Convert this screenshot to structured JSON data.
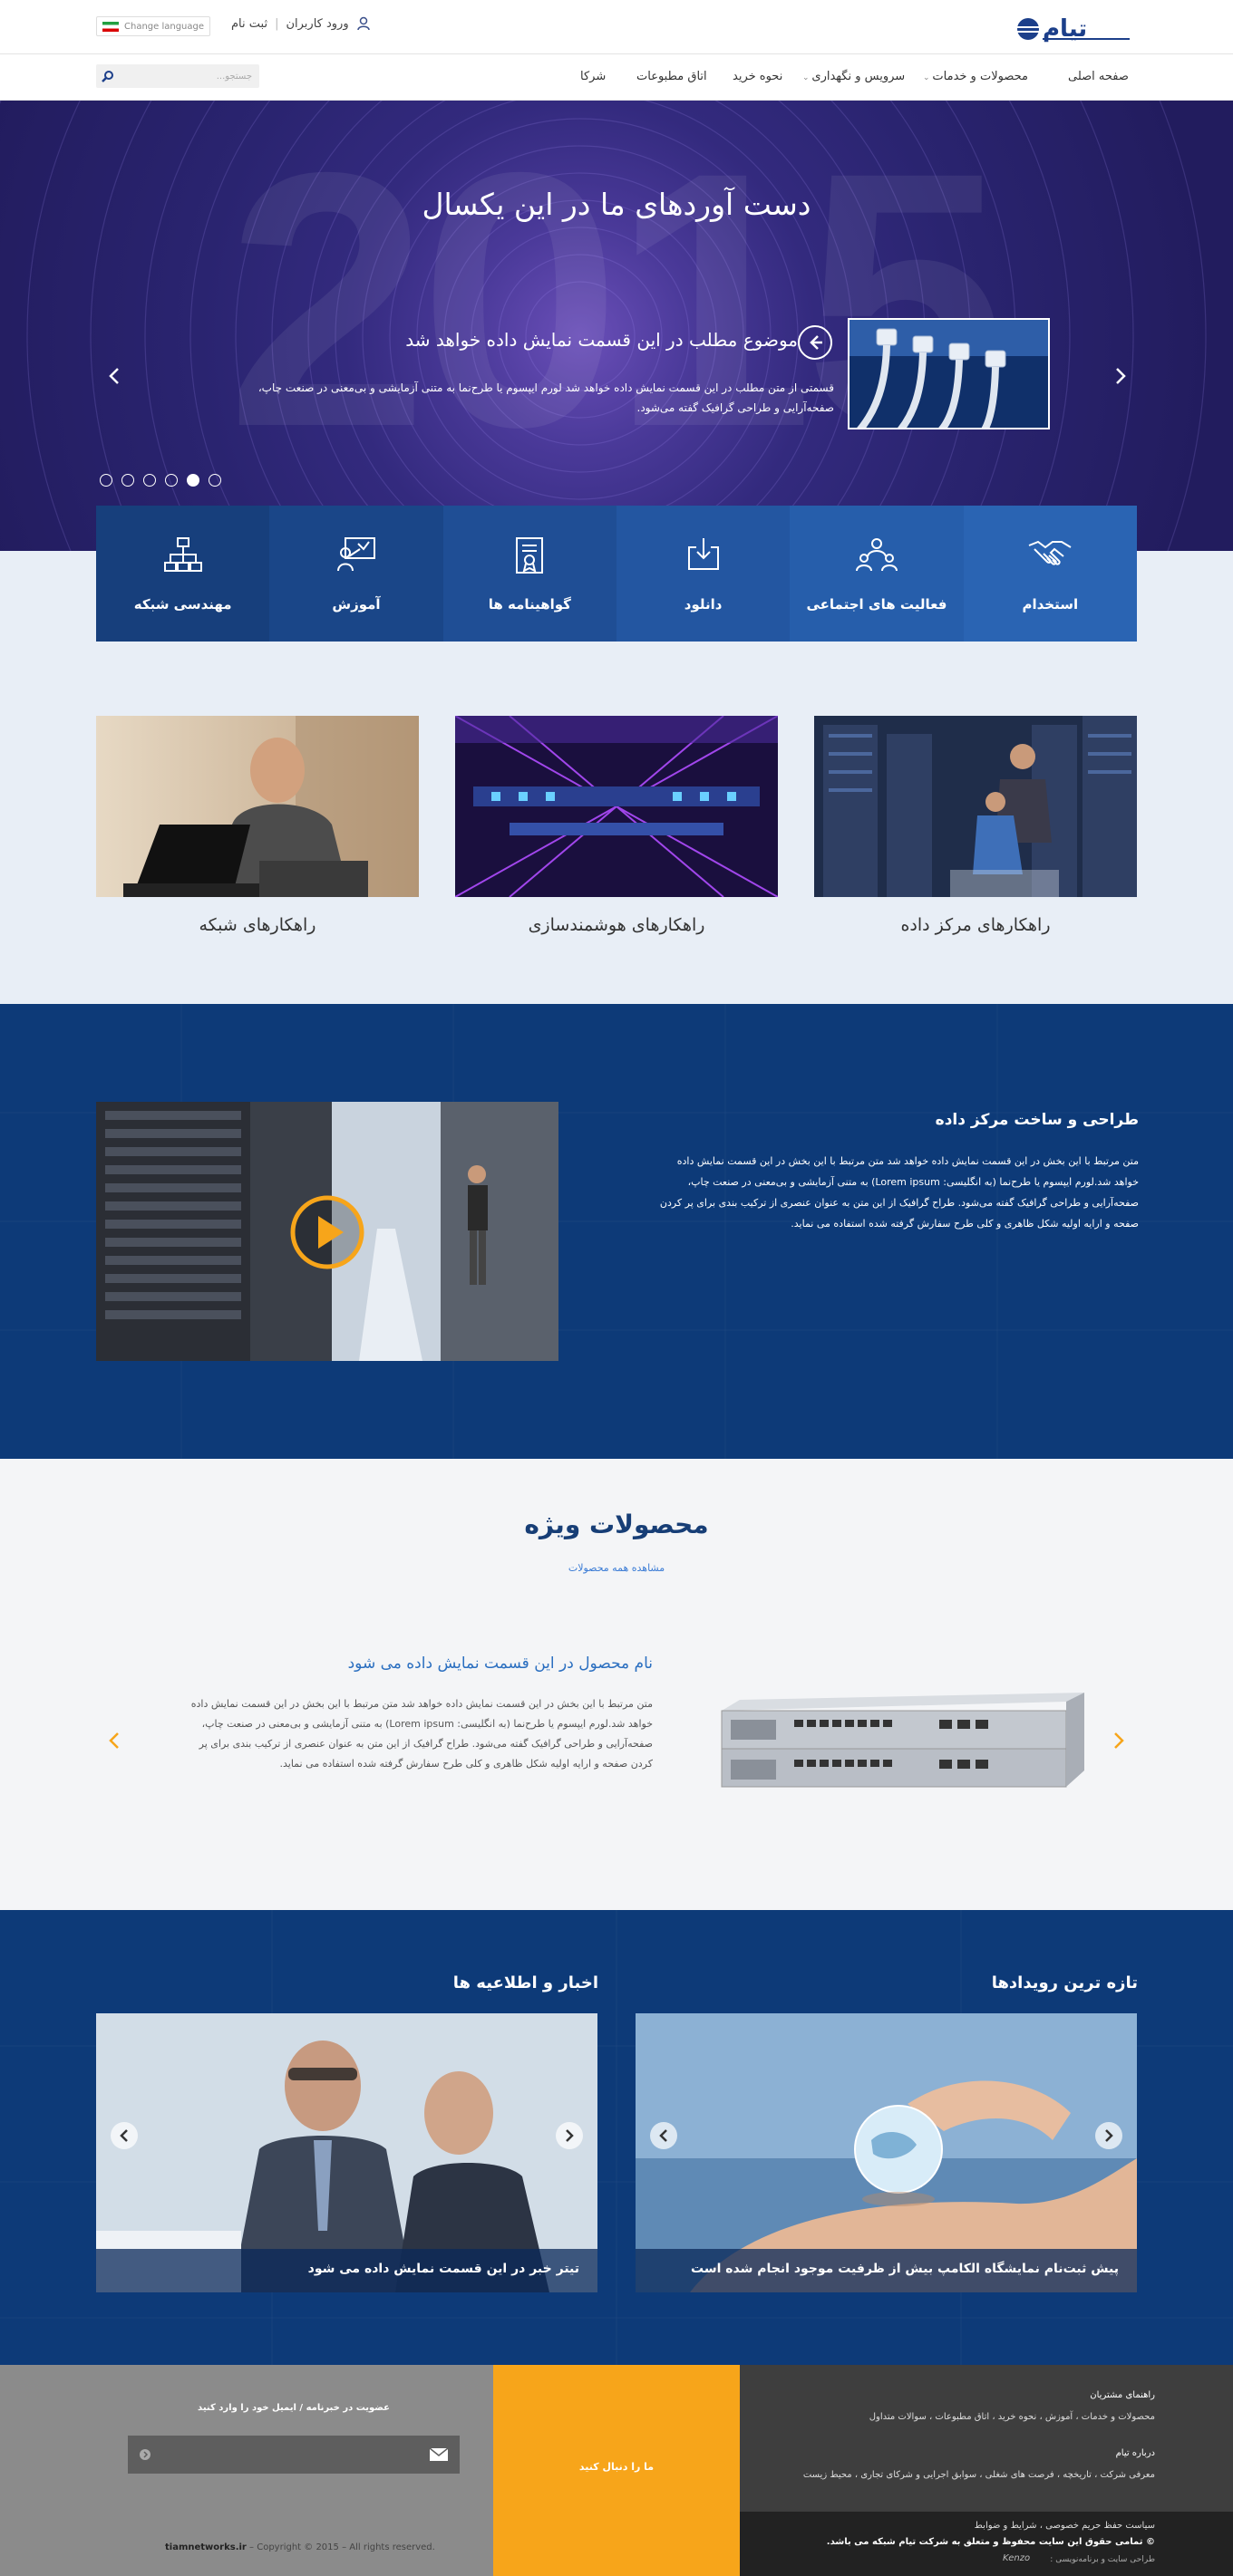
{
  "header": {
    "logo_text": "تیام",
    "login_label": "ورود کاربران",
    "separator": "|",
    "register_label": "ثبت نام",
    "language_label": "Change language"
  },
  "nav": {
    "items": [
      "صفحه اصلی",
      "محصولات و خدمات",
      "سرویس و نگهداری",
      "نحوه خرید",
      "اتاق مطبوعات",
      "شرکا"
    ],
    "search_placeholder": "جستجو..."
  },
  "hero": {
    "title": "دست آوردهای ما در این یکسال",
    "year_watermark": "2015",
    "slide_title": "موضوع مطلب در این قسمت نمایش داده خواهد شد",
    "slide_text": "قسمتی از متن مطلب در این قسمت نمایش داده خواهد شد لورم ایپسوم یا طرح‌نما به متنی آزمایشی و بی‌معنی در صنعت چاپ، صفحه‌آرایی و طراحی گرافیک گفته می‌شود.",
    "dots_count": 6,
    "active_dot": 5
  },
  "tiles": [
    {
      "label": "مهندسی شبکه",
      "icon": "network-icon",
      "color": "#173f7c"
    },
    {
      "label": "آموزش",
      "icon": "training-icon",
      "color": "#1a4688"
    },
    {
      "label": "گواهینامه ها",
      "icon": "certificate-icon",
      "color": "#1f4e95"
    },
    {
      "label": "دانلود",
      "icon": "download-icon",
      "color": "#2356a1"
    },
    {
      "label": "فعالیت های اجتماعی",
      "icon": "community-icon",
      "color": "#265eab"
    },
    {
      "label": "استخدام",
      "icon": "handshake-icon",
      "color": "#2a64b3"
    }
  ],
  "solutions": [
    {
      "label": "راهکارهای شبکه"
    },
    {
      "label": "راهکارهای هوشمندسازی"
    },
    {
      "label": "راهکارهای مرکز داده"
    }
  ],
  "datacenter": {
    "title": "طراحی و ساخت مرکز داده",
    "text": "متن مرتبط با این بخش در این قسمت نمایش داده خواهد شد متن مرتبط با این بخش در این قسمت نمایش داده خواهد شد.لورم ایپسوم یا طرح‌نما (به انگلیسی: Lorem ipsum) به متنی آزمایشی و بی‌معنی در صنعت چاپ، صفحه‌آرایی و طراحی گرافیک گفته می‌شود. طراح گرافیک از این متن به عنوان عنصری از ترکیب بندی برای پر کردن صفحه و ارایه اولیه شکل ظاهری و کلی طرح سفارش گرفته شده استفاده می نماید."
  },
  "featured": {
    "title": "محصولات ویژه",
    "view_all": "مشاهده همه محصولات",
    "product_name": "نام محصول در این قسمت نمایش داده می شود",
    "product_text": "متن مرتبط با این بخش در این قسمت نمایش داده خواهد شد متن مرتبط با این بخش در این قسمت نمایش داده خواهد شد.لورم ایپسوم یا طرح‌نما (به انگلیسی: Lorem ipsum) به متنی آزمایشی و بی‌معنی در صنعت چاپ، صفحه‌آرایی و طراحی گرافیک گفته می‌شود. طراح گرافیک از این متن به عنوان عنصری از ترکیب بندی برای پر کردن صفحه و ارایه اولیه شکل ظاهری و کلی طرح سفارش گرفته شده استفاده می نماید."
  },
  "news": {
    "left_title": "اخبار و اطلاعیه ها",
    "right_title": "تازه ترین رویدادها",
    "left_caption": "تیتر خبر در این قسمت نمایش داده می شود",
    "right_caption": "پیش ثبت‌نام نمایشگاه الکامپ بیش از ظرفیت موجود انجام شده است"
  },
  "footer": {
    "newsletter_title": "عضویت در خبرنامه / ایمیل خود را وارد کنید",
    "follow_us": "ما را دنبال کنید",
    "copyright_site": "tiamnetworks.ir",
    "copyright_text": "– Copyright © 2015 – All rights reserved.",
    "guide_title": "راهنمای مشتریان",
    "guide_links": "محصولات و خدمات ، آموزش ، نحوه خرید ، اتاق مطبوعات ، سوالات متداول",
    "about_title": "درباره تیام",
    "about_links": "معرفی شرکت ، تاریخچه ، فرصت های شغلی ، سوابق اجرایی و شرکای تجاری ، محیط زیست",
    "policy_links": "سیاست حفظ حریم خصوصی ، شرایط و ضوابط",
    "rights_text": "© تمامی حقوق این سایت محفوظ و متعلق به شرکت تیام شبکه می باشد.",
    "designer_text": "طراحی سایت و برنامه‌نویسی :",
    "designer_logo": "Kenzo"
  },
  "colors": {
    "brand_blue": "#0d3a78",
    "accent_orange": "#f7a51a",
    "link_blue": "#2b6fc0"
  }
}
